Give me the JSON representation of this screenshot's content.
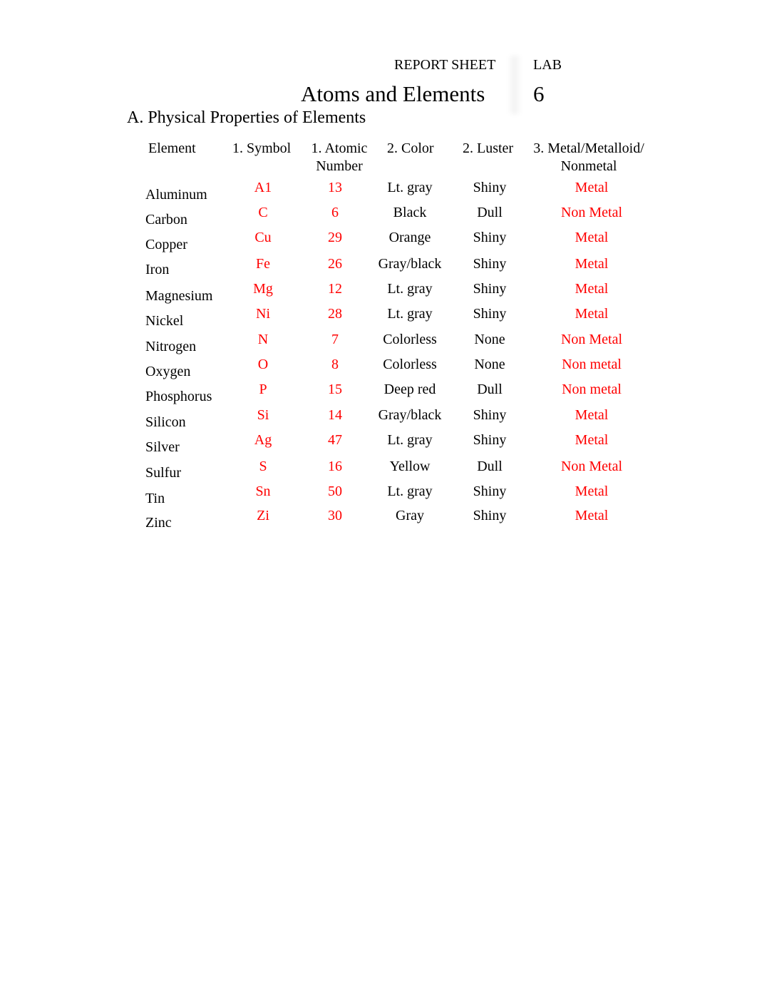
{
  "header": {
    "report_sheet": "REPORT SHEET",
    "lab_label": "LAB",
    "title": "Atoms and Elements",
    "lab_number": "6"
  },
  "section": {
    "title": "A. Physical Properties of Elements"
  },
  "table": {
    "columns": [
      {
        "line1": "Element",
        "line2": ""
      },
      {
        "line1": "1. Symbol",
        "line2": ""
      },
      {
        "line1": "1. Atomic",
        "line2": "Number"
      },
      {
        "line1": "2. Color",
        "line2": ""
      },
      {
        "line1": "2. Luster",
        "line2": ""
      },
      {
        "line1": "3. Metal/Metalloid/",
        "line2": "Nonmetal"
      }
    ],
    "rows": [
      {
        "element": "Aluminum",
        "symbol": "A1",
        "atomic_number": "13",
        "color": "Lt. gray",
        "luster": "Shiny",
        "classification": "Metal"
      },
      {
        "element": "Carbon",
        "symbol": "C",
        "atomic_number": "6",
        "color": "Black",
        "luster": "Dull",
        "classification": "Non Metal"
      },
      {
        "element": "Copper",
        "symbol": "Cu",
        "atomic_number": "29",
        "color": "Orange",
        "luster": "Shiny",
        "classification": "Metal"
      },
      {
        "element": "Iron",
        "symbol": "Fe",
        "atomic_number": "26",
        "color": "Gray/black",
        "luster": "Shiny",
        "classification": "Metal"
      },
      {
        "element": "Magnesium",
        "symbol": "Mg",
        "atomic_number": "12",
        "color": "Lt. gray",
        "luster": "Shiny",
        "classification": "Metal"
      },
      {
        "element": "Nickel",
        "symbol": "Ni",
        "atomic_number": "28",
        "color": "Lt. gray",
        "luster": "Shiny",
        "classification": "Metal"
      },
      {
        "element": "Nitrogen",
        "symbol": "N",
        "atomic_number": "7",
        "color": "Colorless",
        "luster": "None",
        "classification": "Non Metal"
      },
      {
        "element": "Oxygen",
        "symbol": "O",
        "atomic_number": "8",
        "color": "Colorless",
        "luster": "None",
        "classification": "Non metal"
      },
      {
        "element": "Phosphorus",
        "symbol": "P",
        "atomic_number": "15",
        "color": "Deep red",
        "luster": "Dull",
        "classification": "Non metal"
      },
      {
        "element": "Silicon",
        "symbol": "Si",
        "atomic_number": "14",
        "color": "Gray/black",
        "luster": "Shiny",
        "classification": "Metal"
      },
      {
        "element": "Silver",
        "symbol": "Ag",
        "atomic_number": "47",
        "color": "Lt. gray",
        "luster": "Shiny",
        "classification": "Metal"
      },
      {
        "element": "Sulfur",
        "symbol": "S",
        "atomic_number": "16",
        "color": "Yellow",
        "luster": "Dull",
        "classification": "Non Metal"
      },
      {
        "element": "Tin",
        "symbol": "Sn",
        "atomic_number": "50",
        "color": "Lt. gray",
        "luster": "Shiny",
        "classification": "Metal"
      },
      {
        "element": "Zinc",
        "symbol": "Zi",
        "atomic_number": "30",
        "color": "Gray",
        "luster": "Shiny",
        "classification": "Metal"
      }
    ]
  },
  "colors": {
    "answer_text": "#ff0000",
    "body_text": "#000000"
  }
}
